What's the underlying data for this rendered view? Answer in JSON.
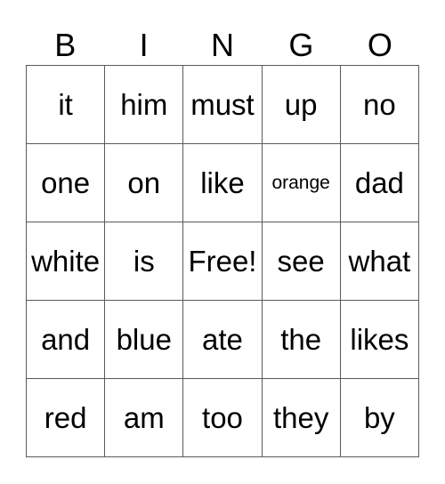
{
  "card": {
    "header": [
      "B",
      "I",
      "N",
      "G",
      "O"
    ],
    "rows": [
      [
        "it",
        "him",
        "must",
        "up",
        "no"
      ],
      [
        "one",
        "on",
        "like",
        "orange",
        "dad"
      ],
      [
        "white",
        "is",
        "Free!",
        "see",
        "what"
      ],
      [
        "and",
        "blue",
        "ate",
        "the",
        "likes"
      ],
      [
        "red",
        "am",
        "too",
        "they",
        "by"
      ]
    ]
  }
}
